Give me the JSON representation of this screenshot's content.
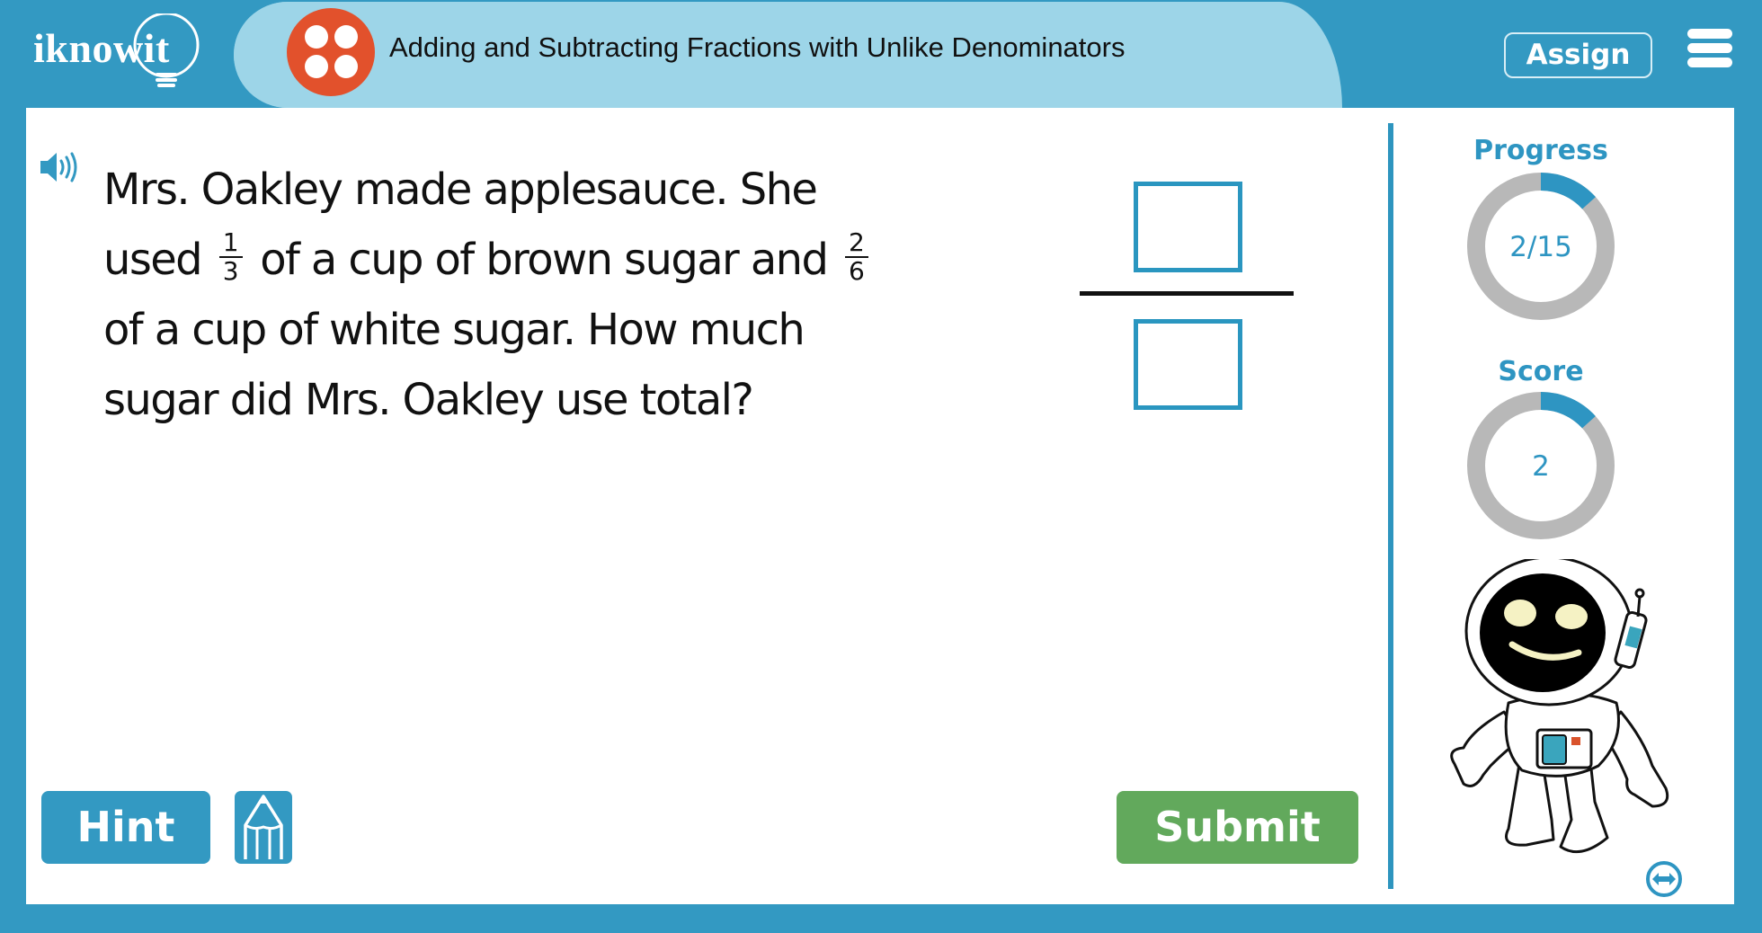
{
  "header": {
    "logo_text": "iknowit",
    "lesson_title": "Adding and Subtracting Fractions with Unlike Denominators",
    "activity_icon": "four-dots-icon",
    "assign_label": "Assign",
    "menu_icon": "hamburger-menu-icon"
  },
  "question": {
    "audio_icon": "speaker-icon",
    "line1": "Mrs. Oakley made applesauce. She",
    "line2_before": "used",
    "fraction1": {
      "numerator": "1",
      "denominator": "3"
    },
    "line2_middle": "of a cup of brown sugar and",
    "fraction2": {
      "numerator": "2",
      "denominator": "6"
    },
    "line3": "of a cup of white sugar. How much",
    "line4": "sugar did Mrs. Oakley use total?"
  },
  "answer": {
    "numerator_value": "",
    "denominator_value": ""
  },
  "buttons": {
    "hint_label": "Hint",
    "pencil_icon": "pencil-icon",
    "submit_label": "Submit",
    "expand_icon": "expand-horizontal-icon"
  },
  "sidebar": {
    "progress": {
      "label": "Progress",
      "value_text": "2/15",
      "current": 2,
      "total": 15
    },
    "score": {
      "label": "Score",
      "value_text": "2",
      "fill_fraction": 0.133
    },
    "mascot": "astronaut-mascot"
  },
  "colors": {
    "brand_blue": "#3399c2",
    "tab_light_blue": "#9dd5e8",
    "activity_orange": "#e2512c",
    "submit_green": "#62a95c",
    "ring_gray": "#b8b8b8"
  }
}
